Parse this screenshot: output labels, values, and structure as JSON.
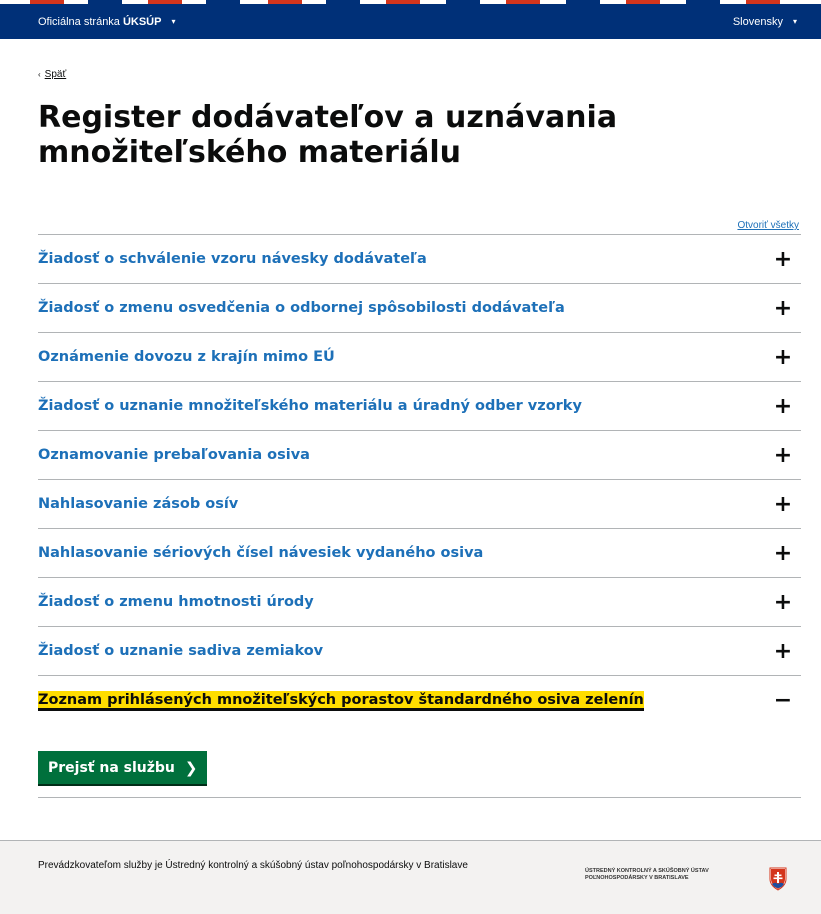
{
  "header": {
    "official_prefix": "Oficiálna stránka",
    "official_org": "ÚKSÚP",
    "official_caret": "▾",
    "language": "Slovensky",
    "language_caret": "▾"
  },
  "colors": {
    "topbar": "#003078",
    "stripe_red": "#d4351c",
    "link": "#1d70b8",
    "focus": "#ffdd00",
    "button": "#00703c"
  },
  "back": {
    "arrow": "‹",
    "label": "Späť"
  },
  "page": {
    "title": "Register dodávateľov a uznávania množiteľského materiálu"
  },
  "accordion": {
    "open_all": "Otvoriť všetky",
    "items": [
      {
        "title": "Žiadosť o schválenie vzoru návesky dodávateľa",
        "sign": "+"
      },
      {
        "title": "Žiadosť o zmenu osvedčenia o odbornej spôsobilosti dodávateľa",
        "sign": "+"
      },
      {
        "title": "Oznámenie dovozu z krajín mimo EÚ",
        "sign": "+"
      },
      {
        "title": "Žiadosť o uznanie množiteľského materiálu a úradný odber vzorky",
        "sign": "+"
      },
      {
        "title": "Oznamovanie prebaľovania osiva",
        "sign": "+"
      },
      {
        "title": "Nahlasovanie zásob osív",
        "sign": "+"
      },
      {
        "title": "Nahlasovanie sériových čísel návesiek vydaného osiva",
        "sign": "+"
      },
      {
        "title": "Žiadosť o zmenu hmotnosti úrody",
        "sign": "+"
      },
      {
        "title": "Žiadosť o uznanie sadiva zemiakov",
        "sign": "+"
      },
      {
        "title": "Zoznam prihlásených množiteľských porastov štandardného osiva zelenín",
        "sign": "−"
      }
    ],
    "start_button": {
      "label": "Prejsť na službu",
      "chevron": "❯"
    }
  },
  "footer": {
    "text": "Prevádzkovateľom služby je Ústredný kontrolný a skúšobný ústav poľnohospodársky v Bratislave",
    "logo_text": "ÚSTREDNÝ KONTROLNÝ A SKÚŠOBNÝ ÚSTAV\nPOĽNOHOSPODÁRSKY V BRATISLAVE"
  }
}
